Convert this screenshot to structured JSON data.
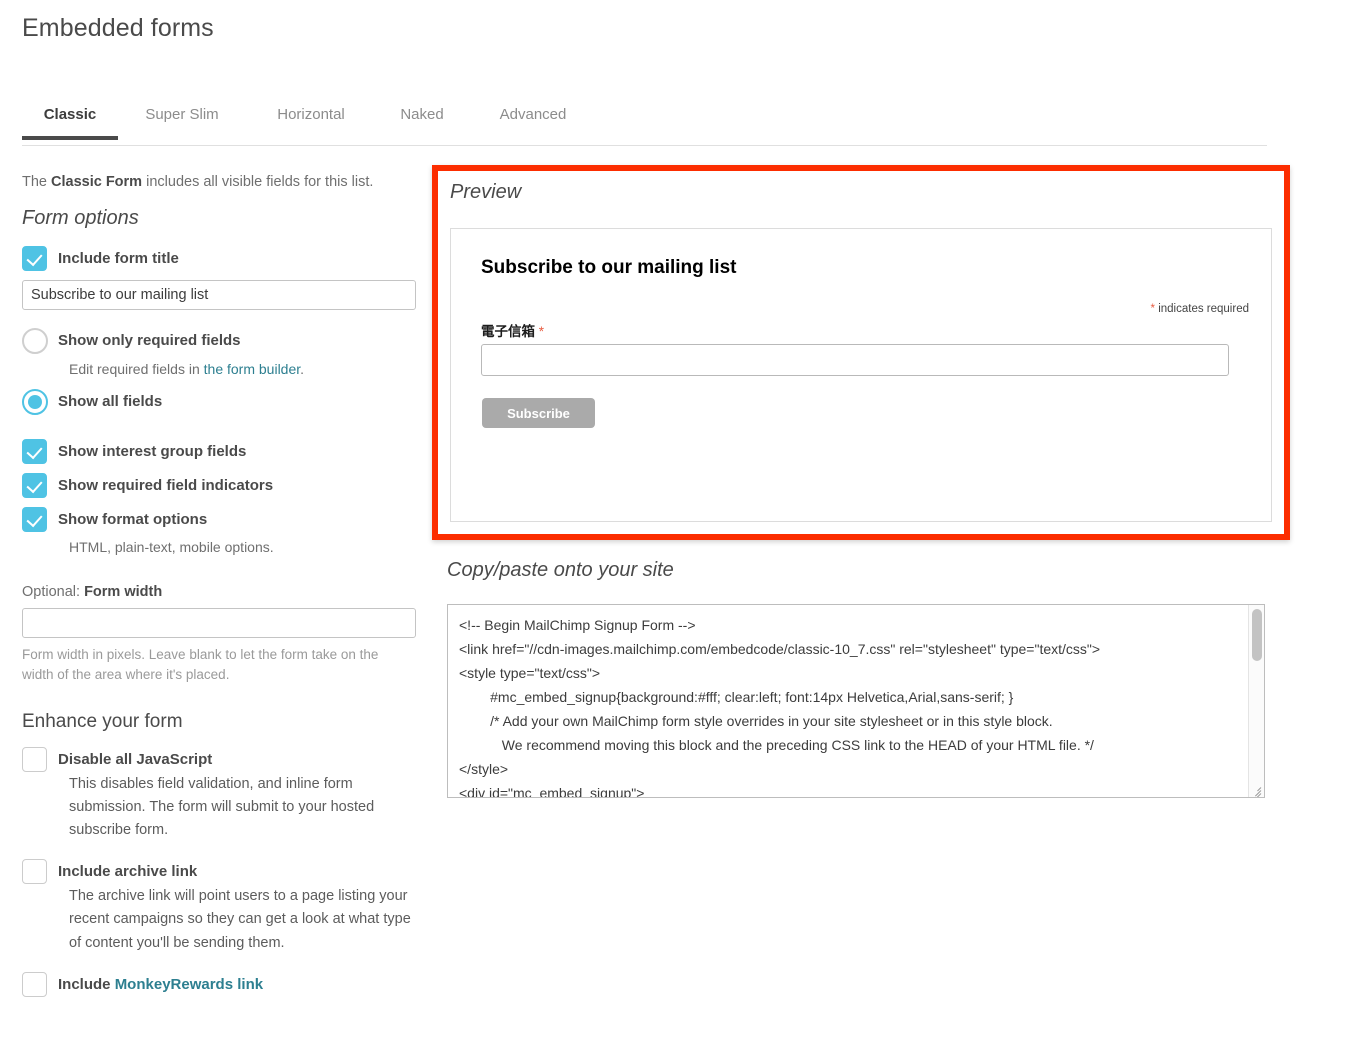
{
  "page": {
    "title": "Embedded forms"
  },
  "tabs": [
    {
      "label": "Classic",
      "active": true
    },
    {
      "label": "Super Slim",
      "active": false
    },
    {
      "label": "Horizontal",
      "active": false
    },
    {
      "label": "Naked",
      "active": false
    },
    {
      "label": "Advanced",
      "active": false
    }
  ],
  "left": {
    "intro_pre": "The ",
    "intro_bold": "Classic Form",
    "intro_post": " includes all visible fields for this list.",
    "form_options_title": "Form options",
    "include_form_title": {
      "label": "Include form title",
      "checked": true
    },
    "form_title_input": {
      "value": "Subscribe to our mailing list",
      "placeholder": ""
    },
    "show_only_required": {
      "label": "Show only required fields",
      "selected": false,
      "help_pre": "Edit required fields in ",
      "help_link": "the form builder",
      "help_post": "."
    },
    "show_all_fields": {
      "label": "Show all fields",
      "selected": true
    },
    "show_interest_group_fields": {
      "label": "Show interest group fields",
      "checked": true
    },
    "show_required_field_indicators": {
      "label": "Show required field indicators",
      "checked": true
    },
    "show_format_options": {
      "label": "Show format options",
      "checked": true,
      "desc": "HTML, plain-text, mobile options."
    },
    "form_width": {
      "label_pre": "Optional: ",
      "label_bold": "Form width",
      "value": "",
      "placeholder": "",
      "help": "Form width in pixels. Leave blank to let the form take on the width of the area where it's placed."
    },
    "enhance_title": "Enhance your form",
    "disable_js": {
      "label": "Disable all JavaScript",
      "checked": false,
      "desc": "This disables field validation, and inline form submission. The form will submit to your hosted subscribe form."
    },
    "include_archive_link": {
      "label": "Include archive link",
      "checked": false,
      "desc": "The archive link will point users to a page listing your recent campaigns so they can get a look at what type of content you'll be sending them."
    },
    "include_monkeyrewards": {
      "label_pre": "Include ",
      "label_link": "MonkeyRewards link",
      "checked": false
    }
  },
  "right": {
    "preview_title": "Preview",
    "preview": {
      "heading": "Subscribe to our mailing list",
      "required_note_asterisk": "*",
      "required_note": " indicates required",
      "email_label": "電子信箱",
      "email_required_asterisk": "*",
      "email_value": "",
      "email_placeholder": "",
      "submit_label": "Subscribe"
    },
    "copy_title": "Copy/paste onto your site",
    "code": "<!-- Begin MailChimp Signup Form -->\n<link href=\"//cdn-images.mailchimp.com/embedcode/classic-10_7.css\" rel=\"stylesheet\" type=\"text/css\">\n<style type=\"text/css\">\n\t#mc_embed_signup{background:#fff; clear:left; font:14px Helvetica,Arial,sans-serif; }\n\t/* Add your own MailChimp form style overrides in your site stylesheet or in this style block.\n\t   We recommend moving this block and the preceding CSS link to the HEAD of your HTML file. */\n</style>\n<div id=\"mc_embed_signup\">"
  },
  "colors": {
    "accent_teal": "#4fc3e4",
    "link_teal": "#2d7f90",
    "highlight_red": "#fc2d00",
    "required_red": "#e85c41",
    "submit_gray": "#aaaaaa",
    "tab_active_underline": "#4a4a4a"
  }
}
